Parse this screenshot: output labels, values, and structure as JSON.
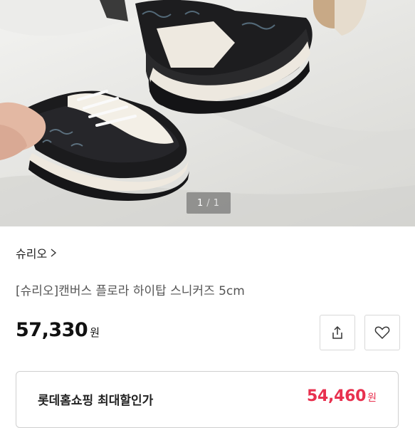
{
  "gallery": {
    "current": "1",
    "separator": "/",
    "total": "1"
  },
  "brand": {
    "name": "슈리오"
  },
  "product": {
    "name": "[슈리오]캔버스 플로라 하이탑 스니커즈 5cm",
    "price": "57,330",
    "currency": "원"
  },
  "actions": {
    "share_icon": "share-icon",
    "wish_icon": "heart-icon"
  },
  "discount": {
    "label": "롯데홈쇼핑 최대할인가",
    "price": "54,460",
    "currency": "원"
  },
  "colors": {
    "accent": "#e8314f",
    "text": "#222222",
    "border": "#d8d8d8"
  }
}
